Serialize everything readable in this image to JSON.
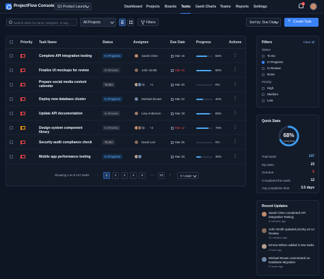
{
  "app": {
    "title": "ProjectFlow Console",
    "project": "Q1 Product Launch",
    "nav": [
      "Dashboard",
      "Projects",
      "Boards",
      "Tasks",
      "Gantt Charts",
      "Teams",
      "Reports",
      "Settings"
    ],
    "active_nav": "Tasks",
    "notifications": "3"
  },
  "toolbar": {
    "search_placeholder": "Search tasks by name, assignee, or tag...",
    "project_filter": "All Projects",
    "filters_label": "Filters",
    "sort_label": "Sort by: Due Date",
    "create_label": "Create Task"
  },
  "table": {
    "headers": [
      "Priority",
      "Task Name",
      "Status",
      "Assignee",
      "Due Date",
      "Progress",
      "Actions"
    ],
    "rows": [
      {
        "priority": "high",
        "task": "Complete API integration testing",
        "status": "In Progress",
        "assignee": "Sarah Chen",
        "extra": "",
        "due": "Mar 15",
        "overdue": false,
        "progress": 65,
        "pct": "65%"
      },
      {
        "priority": "high",
        "task": "Finalize UI mockups for review",
        "status": "In Review",
        "assignee": "John Smith",
        "extra": "",
        "due": "Mar 10",
        "overdue": true,
        "progress": 90,
        "pct": "90%"
      },
      {
        "priority": "high",
        "task": "Prepare social media content calendar",
        "status": "To Do",
        "assignee": "",
        "extra": "+1",
        "due": "Mar 20",
        "overdue": false,
        "progress": 0,
        "pct": "0%"
      },
      {
        "priority": "high",
        "task": "Deploy new database cluster",
        "status": "In Progress",
        "assignee": "Michael Brown",
        "extra": "",
        "due": "Mar 22",
        "overdue": false,
        "progress": 40,
        "pct": "40%"
      },
      {
        "priority": "high",
        "task": "Update API documentation",
        "status": "In Review",
        "assignee": "Lisa Anderson",
        "extra": "",
        "due": "Mar 18",
        "overdue": false,
        "progress": 85,
        "pct": "85%"
      },
      {
        "priority": "medium",
        "task": "Design system component library",
        "status": "In Review",
        "assignee": "",
        "extra": "+2",
        "due": "Mar 12",
        "overdue": true,
        "progress": 75,
        "pct": "75%"
      },
      {
        "priority": "high",
        "task": "Security audit compliance check",
        "status": "To Do",
        "assignee": "David Lee",
        "extra": "",
        "due": "Mar 25",
        "overdue": false,
        "progress": 0,
        "pct": "0%"
      },
      {
        "priority": "high",
        "task": "Mobile app performance testing",
        "status": "In Progress",
        "assignee": "",
        "extra": "",
        "due": "Mar 28",
        "overdue": false,
        "progress": 30,
        "pct": "30%"
      }
    ]
  },
  "pagination": {
    "info": "Showing 1-8 of 147 tasks",
    "pages": [
      "1",
      "2",
      "3",
      "4",
      "5",
      "...",
      "19"
    ],
    "per_page": "8 / page"
  },
  "filters": {
    "title": "Filters",
    "clear": "Clear all",
    "status_label": "Status",
    "status_options": [
      "To Do",
      "In Progress",
      "In Review",
      "Done"
    ],
    "priority_label": "Priority",
    "priority_options": [
      "High",
      "Medium",
      "Low"
    ]
  },
  "stats": {
    "title": "Quick Stats",
    "ring_value": "68%",
    "ring_label": "Complete",
    "ring_fraction": 0.68,
    "rows": [
      {
        "label": "Total tasks",
        "value": "147",
        "color": "#6db0f5"
      },
      {
        "label": "My tasks",
        "value": "23",
        "color": "#eef2f8"
      },
      {
        "label": "Overdue",
        "value": "5",
        "color": "#ef4444"
      },
      {
        "label": "Completed this week",
        "value": "12",
        "color": "#eef2f8"
      },
      {
        "label": "Avg completion time",
        "value": "3.5 days",
        "color": "#eef2f8"
      }
    ]
  },
  "updates": {
    "title": "Recent Updates",
    "items": [
      {
        "text": "Sarah Chen completed API integration Testing",
        "time": "5 minutes ago"
      },
      {
        "text": "John Smith updated priority on UI Review",
        "time": "12 minutes ago"
      },
      {
        "text": "Emma Wilson added 3 new tasks",
        "time": "1 hour ago"
      },
      {
        "text": "Michael Brown commented on Database Migration",
        "time": "2 hours ago"
      }
    ]
  },
  "colors": {
    "accent": "#3b82f6",
    "high": "#ef4444",
    "medium": "#f59e0b",
    "progress": "#4ea8f2",
    "in_progress": "#6db0f5",
    "in_review": "#9aa6b8",
    "to_do": "#c9d1de"
  }
}
